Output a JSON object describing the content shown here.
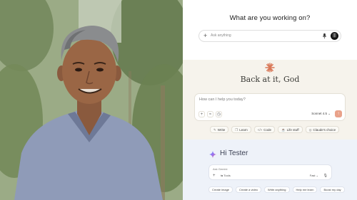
{
  "photo": {
    "subject": ""
  },
  "chatgpt": {
    "heading": "What are you working on?",
    "input_placeholder": "Ask anything",
    "plus_icon": "plus-icon",
    "mic_icon": "mic-icon",
    "send_icon": "voice-wave-icon"
  },
  "claude": {
    "greeting": "Back at it, God",
    "input_placeholder": "How can I help you today?",
    "model": "Sonnet 4.5",
    "accent": "#d97757",
    "chips": [
      {
        "icon": "pencil-icon",
        "glyph": "✎",
        "label": "Write"
      },
      {
        "icon": "book-icon",
        "glyph": "❒",
        "label": "Learn"
      },
      {
        "icon": "code-icon",
        "glyph": "</>",
        "label": "Code"
      },
      {
        "icon": "coffee-icon",
        "glyph": "☕",
        "label": "Life stuff"
      },
      {
        "icon": "lightbulb-icon",
        "glyph": "◎",
        "label": "Claude's choice"
      }
    ]
  },
  "gemini": {
    "greeting": "Hi Tester",
    "input_placeholder": "Ask Gemini",
    "tools_label": "Tools",
    "mode_label": "Fast",
    "chips": [
      {
        "label": "Create image"
      },
      {
        "label": "Create a video"
      },
      {
        "label": "Write anything"
      },
      {
        "label": "Help me learn"
      },
      {
        "label": "Boost my day"
      }
    ]
  }
}
